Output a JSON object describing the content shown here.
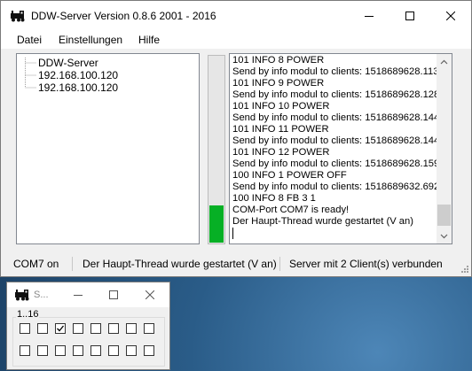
{
  "main_window": {
    "title": "DDW-Server  Version 0.8.6 2001 - 2016",
    "menu": [
      "Datei",
      "Einstellungen",
      "Hilfe"
    ],
    "tree": {
      "root": "DDW-Server",
      "children": [
        "192.168.100.120",
        "192.168.100.120"
      ]
    },
    "progress_fraction": 0.2,
    "log_lines": [
      "101 INFO 8 POWER",
      "Send by info modul to clients: 1518689628.113",
      "101 INFO 9 POWER",
      "Send by info modul to clients: 1518689628.128",
      "101 INFO 10 POWER",
      "Send by info modul to clients: 1518689628.144",
      "101 INFO 11 POWER",
      "Send by info modul to clients: 1518689628.144",
      "101 INFO 12 POWER",
      "Send by info modul to clients: 1518689628.159",
      "100 INFO 1 POWER OFF",
      "Send by info modul to clients: 1518689632.692",
      "100 INFO 8 FB 3 1",
      "COM-Port COM7 is ready!",
      "Der Haupt-Thread wurde gestartet (V an)"
    ],
    "status": {
      "port": "COM7 on",
      "thread": "Der Haupt-Thread wurde gestartet (V an)",
      "clients": "Server mit 2 Client(s) verbunden"
    }
  },
  "small_window": {
    "title": "S...",
    "group_label": "1..16",
    "checkboxes": [
      false,
      false,
      true,
      false,
      false,
      false,
      false,
      false,
      false,
      false,
      false,
      false,
      false,
      false,
      false,
      false
    ]
  },
  "colors": {
    "progress": "#06b025",
    "desktop": "#2a5c88"
  }
}
